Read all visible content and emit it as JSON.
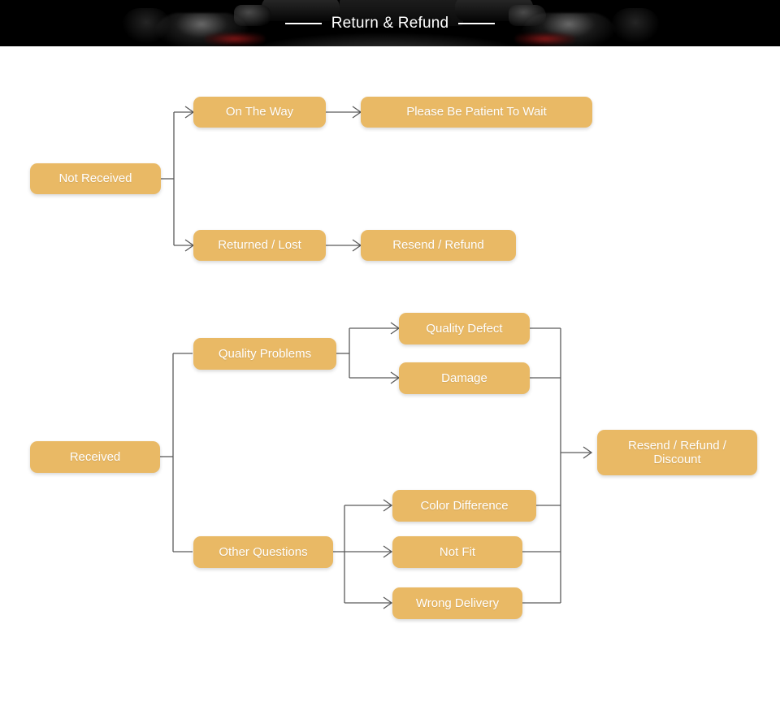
{
  "banner": {
    "title": "Return & Refund",
    "background_color": "#000000",
    "title_color": "#ffffff",
    "rule_left": "",
    "rule_right": ""
  },
  "theme": {
    "node_fill": "#E9B965",
    "node_text": "#ffffff",
    "connector_color": "#5a5a5a",
    "page_background": "#ffffff"
  },
  "flow": {
    "not_received": {
      "root": "Not Received",
      "branches": [
        {
          "label": "On The Way",
          "outcome": "Please Be Patient To Wait"
        },
        {
          "label": "Returned / Lost",
          "outcome": "Resend / Refund"
        }
      ]
    },
    "received": {
      "root": "Received",
      "categories": [
        {
          "label": "Quality Problems",
          "issues": [
            "Quality Defect",
            "Damage"
          ]
        },
        {
          "label": "Other Questions",
          "issues": [
            "Color Difference",
            "Not Fit",
            "Wrong Delivery"
          ]
        }
      ],
      "outcome": "Resend / Refund /\nDiscount"
    }
  }
}
